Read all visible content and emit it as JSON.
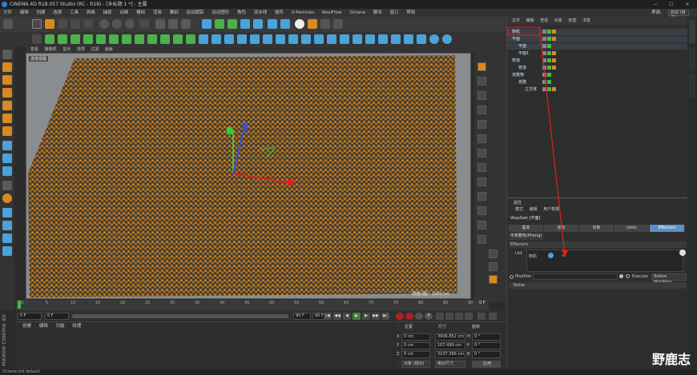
{
  "title": "CINEMA 4D R18.057 Studio (RC - R18) - [未标题 1 *] - 主要",
  "window_controls": [
    "—",
    "☐",
    "✕"
  ],
  "menubar": {
    "items": [
      "文件",
      "编辑",
      "创建",
      "选择",
      "工具",
      "网格",
      "捕捉",
      "动画",
      "模拟",
      "渲染",
      "雕刻",
      "运动跟踪",
      "运动图形",
      "角色",
      "流水线",
      "插件",
      "X-Particles",
      "RealFlow",
      "Octane",
      "脚本",
      "窗口",
      "帮助"
    ],
    "layout_label": "界面:",
    "layout_value": "启动 (用户)"
  },
  "viewport": {
    "menu": [
      "查看",
      "摄像机",
      "显示",
      "选项",
      "过滤",
      "面板"
    ],
    "camera_label": "透视视图",
    "grid_scale": "网格间距：1000 cm"
  },
  "timeline": {
    "ticks": [
      "0",
      "5",
      "10",
      "15",
      "20",
      "25",
      "30",
      "35",
      "40",
      "45",
      "50",
      "55",
      "60",
      "65",
      "70",
      "75",
      "80",
      "85",
      "90"
    ],
    "end_label": "0 F"
  },
  "playbar": {
    "current_frame": "0 F",
    "start_frame": "0 F",
    "end_frame": "90 F",
    "end_frame2": "90 F"
  },
  "materials": {
    "menu": [
      "创建",
      "编辑",
      "功能",
      "纹理"
    ]
  },
  "coordinates": {
    "headers": [
      "位置",
      "尺寸",
      "旋转"
    ],
    "rows": [
      {
        "axis": "X",
        "pos": "0 cm",
        "size": "3906.852 cm",
        "rot_axis": "H",
        "rot": "0 °"
      },
      {
        "axis": "Y",
        "pos": "0 cm",
        "size": "107.499 cm",
        "rot_axis": "P",
        "rot": "0 °"
      },
      {
        "axis": "Z",
        "pos": "0 cm",
        "size": "3107.399 cm",
        "rot_axis": "B",
        "rot": "0 °"
      }
    ],
    "mode_object": "对象 (相对)",
    "mode_size": "绝对尺寸",
    "apply": "应用"
  },
  "object_manager": {
    "tabs": [
      "文件",
      "编辑",
      "查看",
      "对象",
      "标签",
      "书签"
    ],
    "objects": [
      {
        "name": "随机",
        "indent": 0
      },
      {
        "name": "平面",
        "indent": 0
      },
      {
        "name": "平面",
        "indent": 1
      },
      {
        "name": "平面1",
        "indent": 1
      },
      {
        "name": "管道",
        "indent": 0
      },
      {
        "name": "管道",
        "indent": 1
      },
      {
        "name": "克隆物",
        "indent": 0
      },
      {
        "name": "克隆",
        "indent": 1
      },
      {
        "name": "立方体",
        "indent": 2
      }
    ]
  },
  "attributes": {
    "header": "属性",
    "menu": [
      "模式",
      "编辑",
      "用户数据"
    ],
    "object_name": "VoxyGen [平面]",
    "tabs": [
      "基本",
      "坐标",
      "对象",
      "Links",
      "Effectors"
    ],
    "subtab": "平滑着色(Phong)",
    "section": "Effectors",
    "list_label": "List",
    "list_item": "随机",
    "modifier_label": "Modifier",
    "execute_label": "Execute",
    "execute_value": "Before Modifiers",
    "noise_label": "Noise"
  },
  "status_text": "Octane:init default",
  "brand_text": "MAXON CINEMA 4D",
  "watermark": "野鹿志",
  "colors": {
    "accent": "#5b8fc9",
    "particle_orange": "#d98a1f",
    "annotation_red": "#e02020"
  }
}
